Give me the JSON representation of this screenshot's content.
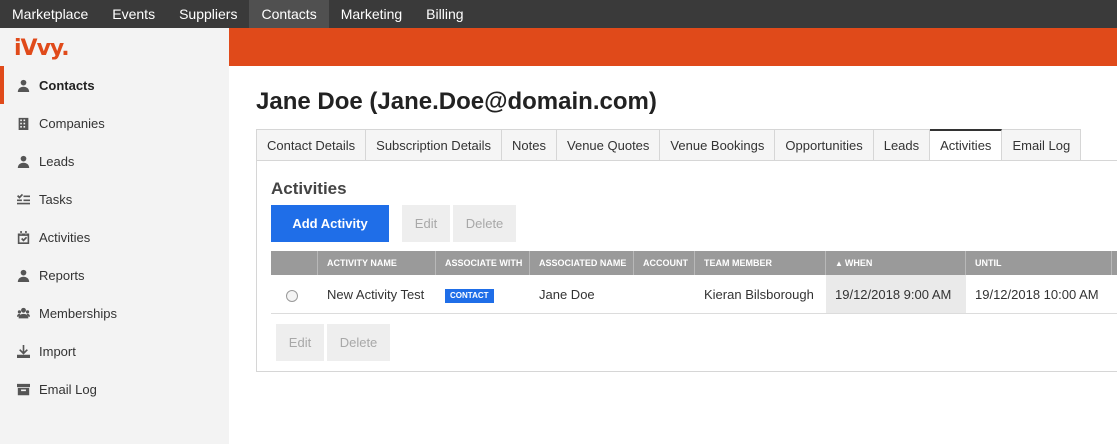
{
  "topnav": {
    "items": [
      {
        "label": "Marketplace"
      },
      {
        "label": "Events"
      },
      {
        "label": "Suppliers"
      },
      {
        "label": "Contacts",
        "active": true
      },
      {
        "label": "Marketing"
      },
      {
        "label": "Billing"
      }
    ]
  },
  "sidebar": {
    "logo": "iVvy.",
    "items": [
      {
        "label": "Contacts",
        "icon": "user-icon",
        "active": true
      },
      {
        "label": "Companies",
        "icon": "building-icon"
      },
      {
        "label": "Leads",
        "icon": "user-icon"
      },
      {
        "label": "Tasks",
        "icon": "checklist-icon"
      },
      {
        "label": "Activities",
        "icon": "calendar-check-icon"
      },
      {
        "label": "Reports",
        "icon": "user-icon"
      },
      {
        "label": "Memberships",
        "icon": "users-icon"
      },
      {
        "label": "Import",
        "icon": "download-icon"
      },
      {
        "label": "Email Log",
        "icon": "archive-icon"
      }
    ]
  },
  "colors": {
    "brand": "#e04a1a",
    "primary_button": "#1f6ee8",
    "topnav_bg": "#3a3a3a"
  },
  "main": {
    "title": "Jane Doe (Jane.Doe@domain.com)",
    "tabs": [
      {
        "label": "Contact Details"
      },
      {
        "label": "Subscription Details"
      },
      {
        "label": "Notes"
      },
      {
        "label": "Venue Quotes"
      },
      {
        "label": "Venue Bookings"
      },
      {
        "label": "Opportunities"
      },
      {
        "label": "Leads"
      },
      {
        "label": "Activities",
        "active": true
      },
      {
        "label": "Email Log"
      }
    ],
    "section_title": "Activities",
    "toolbar": {
      "add_label": "Add Activity",
      "edit_label": "Edit",
      "delete_label": "Delete"
    },
    "grid": {
      "columns": [
        "Activity Name",
        "Associate With",
        "Associated Name",
        "Account",
        "Team Member",
        "When",
        "Until"
      ],
      "sorted_column": "When",
      "rows": [
        {
          "activity_name": "New Activity Test",
          "associate_with": "CONTACT",
          "associated_name": "Jane Doe",
          "account": "",
          "team_member": "Kieran Bilsborough",
          "when": "19/12/2018 9:00 AM",
          "until": "19/12/2018 10:00 AM"
        }
      ]
    },
    "footer_toolbar": {
      "edit_label": "Edit",
      "delete_label": "Delete"
    }
  }
}
